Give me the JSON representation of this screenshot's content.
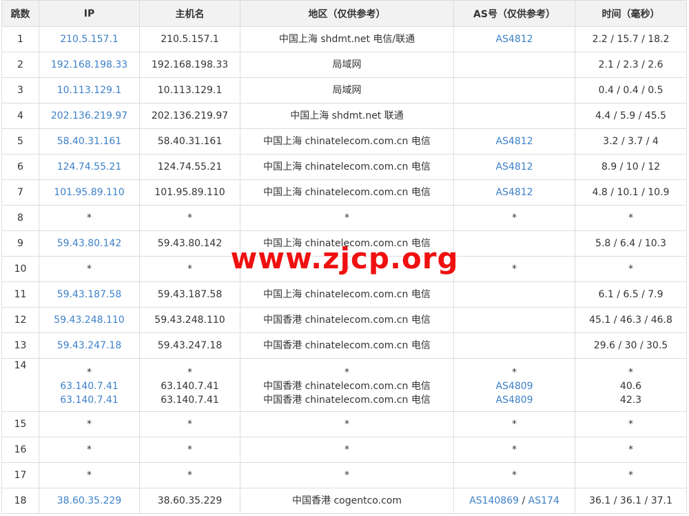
{
  "header": [
    "跳数",
    "IP",
    "主机名",
    "地区（仅供参考）",
    "AS号（仅供参考）",
    "时间（毫秒）"
  ],
  "rows": [
    {
      "hop": "1",
      "lines": [
        {
          "ip": "210.5.157.1",
          "host": "210.5.157.1",
          "region": "中国上海 shdmt.net 电信/联通",
          "as": [
            "AS4812"
          ],
          "time": "2.2 / 15.7 / 18.2"
        }
      ]
    },
    {
      "hop": "2",
      "lines": [
        {
          "ip": "192.168.198.33",
          "host": "192.168.198.33",
          "region": "局域网",
          "as": [],
          "time": "2.1 / 2.3 / 2.6"
        }
      ]
    },
    {
      "hop": "3",
      "lines": [
        {
          "ip": "10.113.129.1",
          "host": "10.113.129.1",
          "region": "局域网",
          "as": [],
          "time": "0.4 / 0.4 / 0.5"
        }
      ]
    },
    {
      "hop": "4",
      "lines": [
        {
          "ip": "202.136.219.97",
          "host": "202.136.219.97",
          "region": "中国上海 shdmt.net 联通",
          "as": [],
          "time": "4.4 / 5.9 / 45.5"
        }
      ]
    },
    {
      "hop": "5",
      "lines": [
        {
          "ip": "58.40.31.161",
          "host": "58.40.31.161",
          "region": "中国上海 chinatelecom.com.cn 电信",
          "as": [
            "AS4812"
          ],
          "time": "3.2 / 3.7 / 4"
        }
      ]
    },
    {
      "hop": "6",
      "lines": [
        {
          "ip": "124.74.55.21",
          "host": "124.74.55.21",
          "region": "中国上海 chinatelecom.com.cn 电信",
          "as": [
            "AS4812"
          ],
          "time": "8.9 / 10 / 12"
        }
      ]
    },
    {
      "hop": "7",
      "lines": [
        {
          "ip": "101.95.89.110",
          "host": "101.95.89.110",
          "region": "中国上海 chinatelecom.com.cn 电信",
          "as": [
            "AS4812"
          ],
          "time": "4.8 / 10.1 / 10.9"
        }
      ]
    },
    {
      "hop": "8",
      "lines": [
        {
          "ip": "*",
          "host": "*",
          "region": "*",
          "as": [
            "*"
          ],
          "time": "*"
        }
      ]
    },
    {
      "hop": "9",
      "lines": [
        {
          "ip": "59.43.80.142",
          "host": "59.43.80.142",
          "region": "中国上海 chinatelecom.com.cn 电信",
          "as": [],
          "time": "5.8 / 6.4 / 10.3"
        }
      ]
    },
    {
      "hop": "10",
      "lines": [
        {
          "ip": "*",
          "host": "*",
          "region": "*",
          "as": [
            "*"
          ],
          "time": "*"
        }
      ]
    },
    {
      "hop": "11",
      "lines": [
        {
          "ip": "59.43.187.58",
          "host": "59.43.187.58",
          "region": "中国上海 chinatelecom.com.cn 电信",
          "as": [],
          "time": "6.1 / 6.5 / 7.9"
        }
      ]
    },
    {
      "hop": "12",
      "lines": [
        {
          "ip": "59.43.248.110",
          "host": "59.43.248.110",
          "region": "中国香港 chinatelecom.com.cn 电信",
          "as": [],
          "time": "45.1 / 46.3 / 46.8"
        }
      ]
    },
    {
      "hop": "13",
      "lines": [
        {
          "ip": "59.43.247.18",
          "host": "59.43.247.18",
          "region": "中国香港 chinatelecom.com.cn 电信",
          "as": [],
          "time": "29.6 / 30 / 30.5"
        }
      ]
    },
    {
      "hop": "14",
      "lines": [
        {
          "ip": "*",
          "host": "*",
          "region": "*",
          "as": [
            "*"
          ],
          "time": "*"
        },
        {
          "ip": "63.140.7.41",
          "host": "63.140.7.41",
          "region": "中国香港 chinatelecom.com.cn 电信",
          "as": [
            "AS4809"
          ],
          "time": "40.6"
        },
        {
          "ip": "63.140.7.41",
          "host": "63.140.7.41",
          "region": "中国香港 chinatelecom.com.cn 电信",
          "as": [
            "AS4809"
          ],
          "time": "42.3"
        }
      ]
    },
    {
      "hop": "15",
      "lines": [
        {
          "ip": "*",
          "host": "*",
          "region": "*",
          "as": [
            "*"
          ],
          "time": "*"
        }
      ]
    },
    {
      "hop": "16",
      "lines": [
        {
          "ip": "*",
          "host": "*",
          "region": "*",
          "as": [
            "*"
          ],
          "time": "*"
        }
      ]
    },
    {
      "hop": "17",
      "lines": [
        {
          "ip": "*",
          "host": "*",
          "region": "*",
          "as": [
            "*"
          ],
          "time": "*"
        }
      ]
    },
    {
      "hop": "18",
      "lines": [
        {
          "ip": "38.60.35.229",
          "host": "38.60.35.229",
          "region": "中国香港 cogentco.com",
          "as": [
            "AS140869",
            "AS174"
          ],
          "time": "36.1 / 36.1 / 37.1"
        }
      ]
    }
  ],
  "as_separator": " / ",
  "watermark": "www.zjcp.org",
  "colors": {
    "link": "#3c80c8",
    "text": "#333333",
    "header_bg": "#f2f2f2",
    "border": "#dcdcdc",
    "watermark": "#f01010"
  }
}
